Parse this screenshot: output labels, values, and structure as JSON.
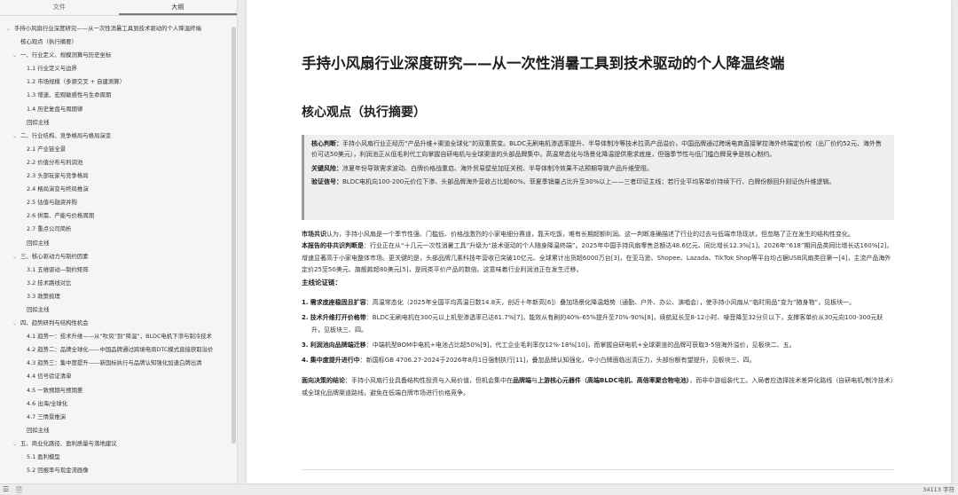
{
  "sidebar": {
    "tabs": [
      {
        "label": "文件",
        "active": false
      },
      {
        "label": "大纲",
        "active": true
      }
    ],
    "outline": [
      {
        "level": 0,
        "caret": true,
        "label": "手持小风扇行业深度研究——从一次性消暑工具到技术驱动的个人降温终端"
      },
      {
        "level": 1,
        "caret": false,
        "label": "核心观点（执行摘要）"
      },
      {
        "level": 1,
        "caret": true,
        "label": "一、行业定义、规模测算与历史坐标"
      },
      {
        "level": 2,
        "caret": false,
        "label": "1.1 行业定义与边界"
      },
      {
        "level": 2,
        "caret": false,
        "label": "1.2 市场规模（多源交叉 + 自建测算）"
      },
      {
        "level": 2,
        "caret": false,
        "label": "1.3 增速、宏观敏感性与生命周期"
      },
      {
        "level": 2,
        "caret": false,
        "label": "1.4 历史复盘与周期律"
      },
      {
        "level": 2,
        "caret": false,
        "label": "回扣主线"
      },
      {
        "level": 1,
        "caret": true,
        "label": "二、行业结构、竞争格局与格局演变"
      },
      {
        "level": 2,
        "caret": false,
        "label": "2.1 产业链全景"
      },
      {
        "level": 2,
        "caret": false,
        "label": "2.2 价值分布与利润池"
      },
      {
        "level": 2,
        "caret": false,
        "label": "2.3 头部玩家与竞争格局"
      },
      {
        "level": 2,
        "caret": false,
        "label": "2.4 格局演变与终局推演"
      },
      {
        "level": 2,
        "caret": false,
        "label": "2.5 估值与融资并购"
      },
      {
        "level": 2,
        "caret": false,
        "label": "2.6 供需、产能与价格周期"
      },
      {
        "level": 2,
        "caret": false,
        "label": "2.7 重点公司简析"
      },
      {
        "level": 2,
        "caret": false,
        "label": "回扣主线"
      },
      {
        "level": 1,
        "caret": true,
        "label": "三、核心驱动力与制约因素"
      },
      {
        "level": 2,
        "caret": false,
        "label": "3.1 五维驱动—制约矩阵"
      },
      {
        "level": 2,
        "caret": false,
        "label": "3.2 技术路线对比"
      },
      {
        "level": 2,
        "caret": false,
        "label": "3.3 政策梳理"
      },
      {
        "level": 2,
        "caret": false,
        "label": "回扣主线"
      },
      {
        "level": 1,
        "caret": true,
        "label": "四、趋势研判与结构性机会"
      },
      {
        "level": 2,
        "caret": false,
        "label": "4.1 趋势一：技术升维——从“吹风”到“降温”，BLDC电机下渗与制冷技术"
      },
      {
        "level": 2,
        "caret": false,
        "label": "4.2 趋势二：品牌全球化——中国品牌通过跨境电商DTC模式直接获取溢价"
      },
      {
        "level": 2,
        "caret": false,
        "label": "4.3 趋势三：集中度提升——新国标执行与品牌认知强化加速白牌出清"
      },
      {
        "level": 2,
        "caret": false,
        "label": "4.4 信号验证清单"
      },
      {
        "level": 2,
        "caret": false,
        "label": "4.5 一致预期与预期差"
      },
      {
        "level": 2,
        "caret": false,
        "label": "4.6 出海/全球化"
      },
      {
        "level": 2,
        "caret": false,
        "label": "4.7 三情景推演"
      },
      {
        "level": 2,
        "caret": false,
        "label": "回扣主线"
      },
      {
        "level": 1,
        "caret": true,
        "label": "五、商业化路径、盈利质量与落地建议"
      },
      {
        "level": 2,
        "caret": false,
        "label": "5.1 盈利模型"
      },
      {
        "level": 2,
        "caret": false,
        "label": "5.2 回报率与现金流画像"
      }
    ]
  },
  "statusbar": {
    "word_count": "34113 字符"
  },
  "document": {
    "title": "手持小风扇行业深度研究——从一次性消暑工具到技术驱动的个人降温终端",
    "section_heading": "核心观点（执行摘要）",
    "callout": [
      {
        "label": "核心判断：",
        "text": "手持小风扇行业正经历“产品升维+渠道全球化”的双重质变。BLDC无刷电机渗透率提升、半导体制冷等技术拉高产品溢价，中国品牌通过跨境电商直接掌控海外终端定价权（出厂价约52元、海外售价可达50美元），利润池正从低毛利代工向掌握自研电机与全球渠道的头部品牌集中。高温常态化与场景化降温提供需求底座，但强季节性与低门槛白牌竞争是核心制约。"
      },
      {
        "label": "关键风险：",
        "text": "凉夏年份导致需求波动、白牌价格战重启、海外贸易壁垒加征关税、半导体制冷效果不达预期导致产品升维受阻。"
      },
      {
        "label": "验证信号：",
        "text": "BLDC电机向100-200元价位下渗、头部品牌海外营收占比超60%、菲夏季销量占比升至30%以上——三者印证主线；若行业平均客单价持续下行、白牌份额回升则证伪升维逻辑。"
      }
    ],
    "market_consensus": {
      "label": "市场共识",
      "text": "认为，手持小风扇是一个季节性强、门槛低、价格战激烈的小家电细分赛道，靠天吃饭，难有长期超额利润。这一判断准确描述了行业的过去与低端市场现状，但忽略了正在发生的结构性变化。"
    },
    "non_consensus": {
      "label": "本报告的非共识判断是",
      "text": "：行业正在从“十几元一次性消暑工具”升级为“技术驱动的个人随身降温终端”。2025年中国手持风扇零售总额达48.6亿元、同比增长12.3%[1]，2026年“618”期间品类同比增长达160%[2]，增速显著高于小家电整体市场。更关键的是，头部品牌几素科技年营收已突破10亿元、全球累计出货超6000万台[3]，在亚马逊、Shopee、Lazada、TikTok Shop等平台均占据USB风扇类目第一[4]，主流产品海外定价25至50美元、旗舰款超80美元[5]，是同类平价产品的数倍。这意味着行业利润池正在发生迁移。"
    },
    "thesis_heading": "主线论证链：",
    "points": [
      {
        "num": "1.",
        "label": "需求底座稳固且扩容",
        "text": "：高温常态化（2025年全国平均高温日数14.8天，创近十年新高[6]）叠加场景化降温趋势（通勤、户外、办公、演唱会），使手持小风扇从“临时用品”变为“随身物”，见板块一。"
      },
      {
        "num": "2.",
        "label": "技术升维打开价格带",
        "text": "：BLDC无刷电机在300元以上机型渗透率已达61.7%[7]，能效从有刷的40%-65%提升至70%-90%[8]，续航延长至8-12小时、噪音降至32分贝以下，支撑客单价从30元向100-300元跃升，见板块三、四。"
      },
      {
        "num": "3.",
        "label": "利润池向品牌端迁移",
        "text": "：中端机型BOM中电机+电池占比超50%[9]，代工企业毛利率仅12%-18%[10]，而掌握自研电机+全球渠道的品牌可获取3-5倍海外溢价，见板块二、五。"
      },
      {
        "num": "4.",
        "label": "集中度提升进行中",
        "text": "：新国标GB 4706.27-2024于2026年8月1日强制执行[11]，叠加品牌认知强化，中小白牌面临出清压力，头部份额有望提升，见板块三、四。"
      }
    ],
    "conclusion": {
      "label": "面向决策的结论",
      "text_a": "：手持小风扇行业具备结构性投资与入局价值，但机会集中在",
      "bold_a": "品牌端",
      "text_b": "与",
      "bold_b": "上游核心元器件（高端BLDC电机、高倍率聚合物电池）",
      "text_c": "，而非中游组装代工。入局者应选择技术差异化路线（自研电机/制冷技术）或全球化品牌渠道路线，避免在低端白牌市场进行价格竞争。"
    }
  }
}
